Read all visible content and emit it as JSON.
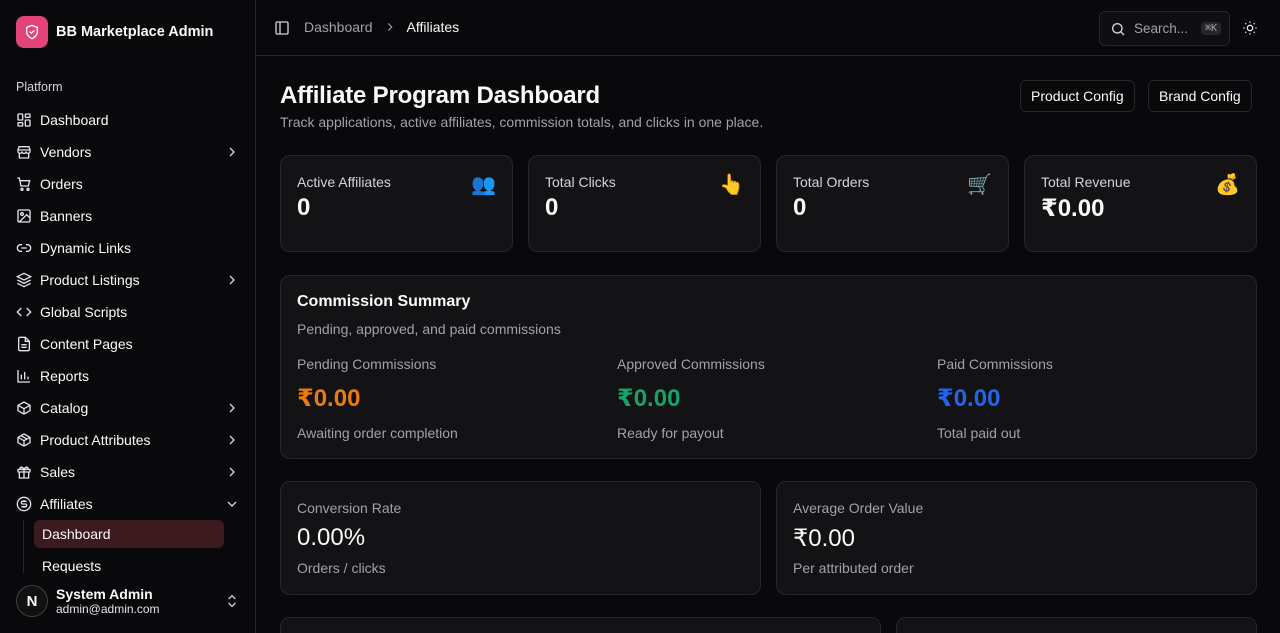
{
  "sidebar": {
    "brand": "BB Marketplace Admin",
    "group_label": "Platform",
    "items": [
      {
        "label": "Dashboard",
        "icon": "dashboard-icon"
      },
      {
        "label": "Vendors",
        "icon": "store-icon"
      },
      {
        "label": "Orders",
        "icon": "cart-icon"
      },
      {
        "label": "Banners",
        "icon": "image-icon"
      },
      {
        "label": "Dynamic Links",
        "icon": "link-icon"
      },
      {
        "label": "Product Listings",
        "icon": "layers-icon"
      },
      {
        "label": "Global Scripts",
        "icon": "code-icon"
      },
      {
        "label": "Content Pages",
        "icon": "file-icon"
      },
      {
        "label": "Reports",
        "icon": "bar-chart-icon"
      },
      {
        "label": "Catalog",
        "icon": "box-icon"
      },
      {
        "label": "Product Attributes",
        "icon": "package-icon"
      },
      {
        "label": "Sales",
        "icon": "gift-icon"
      },
      {
        "label": "Affiliates",
        "icon": "dollar-circle-icon"
      }
    ],
    "affiliates_sub": [
      {
        "label": "Dashboard"
      },
      {
        "label": "Requests"
      }
    ],
    "user": {
      "initial": "N",
      "name": "System Admin",
      "email": "admin@admin.com"
    }
  },
  "topbar": {
    "breadcrumb_parent": "Dashboard",
    "breadcrumb_current": "Affiliates",
    "search_placeholder": "Search...",
    "search_shortcut": "⌘K"
  },
  "header": {
    "title": "Affiliate Program Dashboard",
    "subtitle": "Track applications, active affiliates, commission totals, and clicks in one place.",
    "product_config_label": "Product Config",
    "brand_config_label": "Brand Config"
  },
  "stats": [
    {
      "label": "Active Affiliates",
      "value": "0",
      "emoji": "👥"
    },
    {
      "label": "Total Clicks",
      "value": "0",
      "emoji": "👆"
    },
    {
      "label": "Total Orders",
      "value": "0",
      "emoji": "🛒"
    },
    {
      "label": "Total Revenue",
      "value": "₹0.00",
      "emoji": "💰"
    }
  ],
  "commission": {
    "title": "Commission Summary",
    "subtitle": "Pending, approved, and paid commissions",
    "columns": [
      {
        "label": "Pending Commissions",
        "value": "₹0.00",
        "note": "Awaiting order completion",
        "color": "#ea7a12"
      },
      {
        "label": "Approved Commissions",
        "value": "₹0.00",
        "note": "Ready for payout",
        "color": "#17a26a"
      },
      {
        "label": "Paid Commissions",
        "value": "₹0.00",
        "note": "Total paid out",
        "color": "#2563eb"
      }
    ]
  },
  "metrics": [
    {
      "label": "Conversion Rate",
      "value": "0.00%",
      "note": "Orders / clicks"
    },
    {
      "label": "Average Order Value",
      "value": "₹0.00",
      "note": "Per attributed order"
    }
  ]
}
